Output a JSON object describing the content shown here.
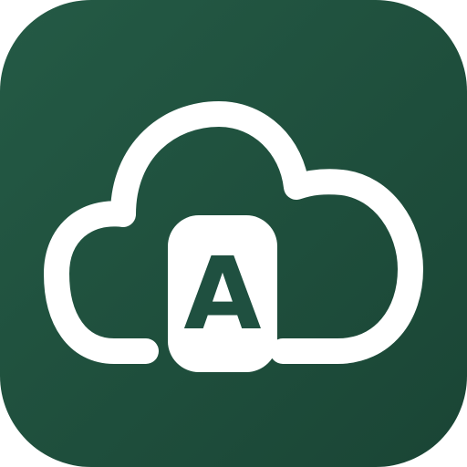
{
  "app_icon": {
    "name": "cloud-letter-app-icon",
    "badge_letter": "A",
    "colors": {
      "background_top": "#245a45",
      "background_bottom": "#1a4535",
      "cloud_stroke": "#ffffff",
      "badge_fill": "#ffffff",
      "letter_color": "#1f5040"
    },
    "icons": [
      "cloud-icon",
      "letter-badge-icon"
    ]
  }
}
